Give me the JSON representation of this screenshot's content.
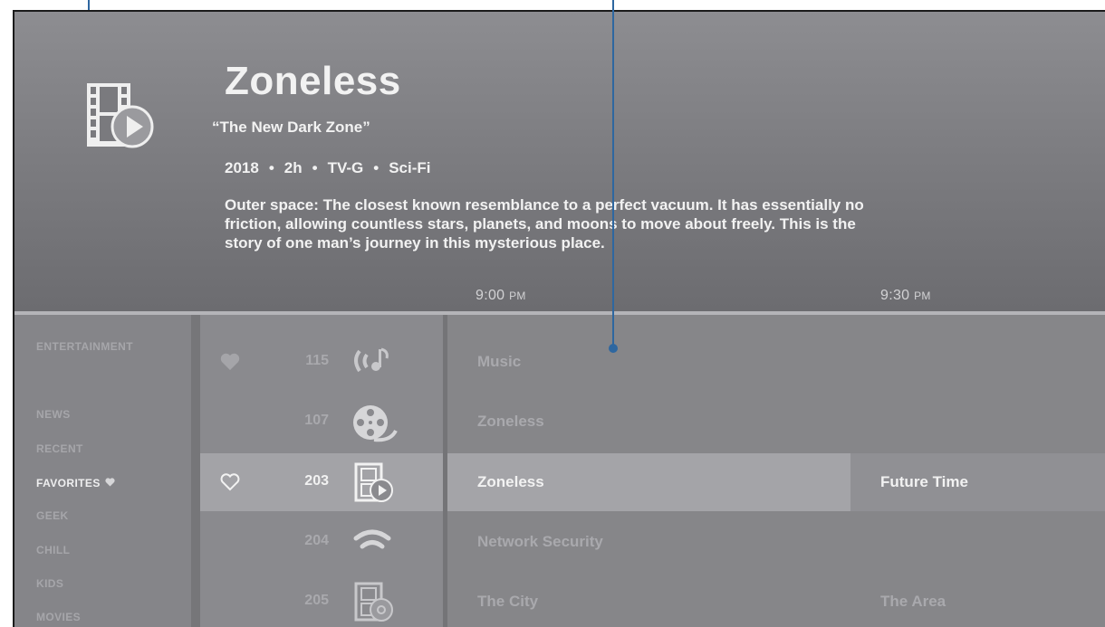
{
  "header": {
    "title": "Zoneless",
    "episode": "“The New Dark Zone”",
    "year": "2018",
    "duration": "2h",
    "rating": "TV-G",
    "genre": "Sci-Fi",
    "separator": "•",
    "description": "Outer space: The closest known resemblance to a perfect vacuum. It has essentially no friction, allowing countless stars, planets, and moons to move about freely. This is the story of one man’s journey in this mysterious place.",
    "icon": "film-play-icon"
  },
  "timeline": {
    "slot1": {
      "time": "9:00",
      "period": "PM"
    },
    "slot2": {
      "time": "9:30",
      "period": "PM"
    }
  },
  "categories": {
    "entertainment": "ENTERTAINMENT",
    "news": "NEWS",
    "recent": "RECENT",
    "favorites": "FAVORITES",
    "geek": "GEEK",
    "chill": "CHILL",
    "kids": "KIDS",
    "movies": "MOVIES",
    "active": "FAVORITES"
  },
  "channels": [
    {
      "number": "115",
      "logo": "music-broadcast-icon",
      "favorite": "filled",
      "programs": [
        "Music"
      ]
    },
    {
      "number": "107",
      "logo": "film-reel-icon",
      "favorite": "none",
      "programs": [
        "Zoneless"
      ]
    },
    {
      "number": "203",
      "logo": "film-play-icon",
      "favorite": "outline",
      "programs": [
        "Zoneless",
        "Future Time"
      ],
      "selected": true
    },
    {
      "number": "204",
      "logo": "wifi-icon",
      "favorite": "none",
      "programs": [
        "Network Security"
      ]
    },
    {
      "number": "205",
      "logo": "film-disc-icon",
      "favorite": "none",
      "programs": [
        "The City",
        "The Area"
      ]
    }
  ],
  "colors": {
    "accent_pin": "#2e67a0",
    "header_bg": "#7a7a7e",
    "selected_row": "#a4a4a8",
    "text_bright": "#f2f2f2",
    "text_dim": "#a9a9ad"
  }
}
